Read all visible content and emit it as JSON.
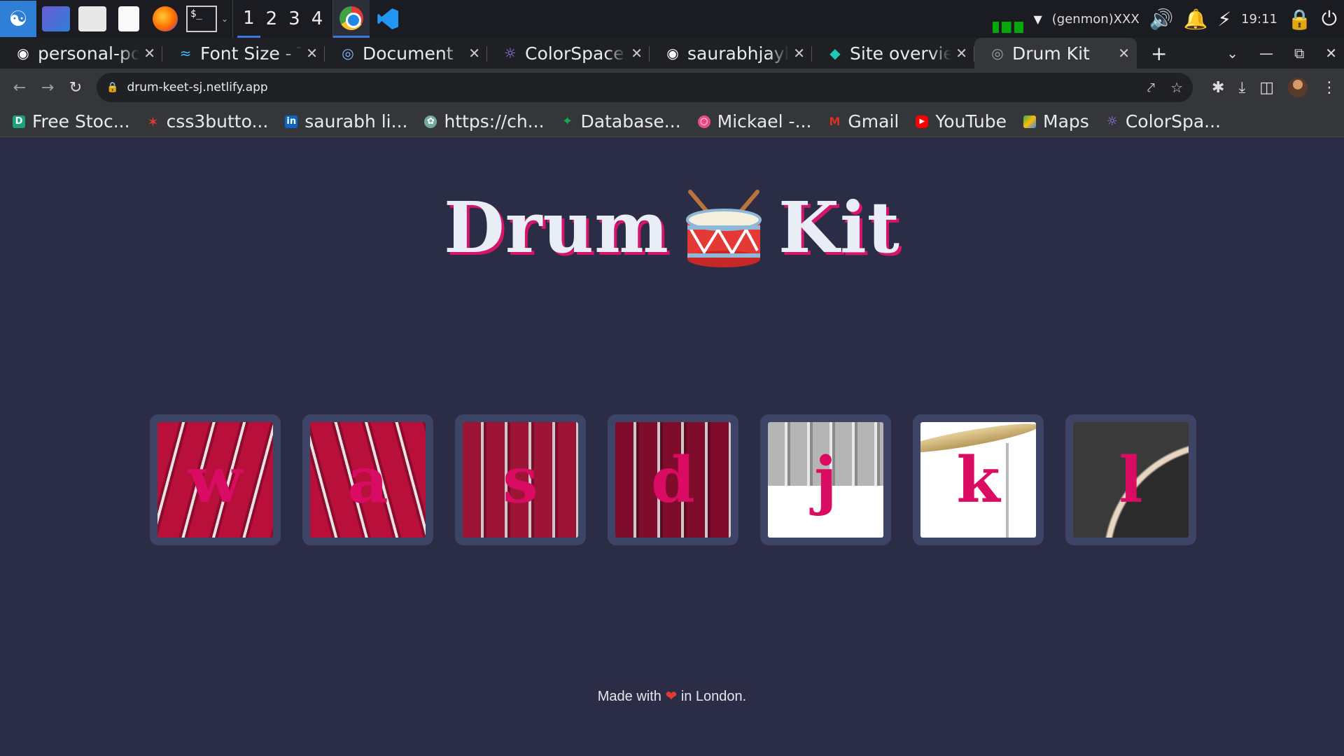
{
  "taskbar": {
    "workspaces": [
      "1",
      "2",
      "3",
      "4"
    ],
    "active_workspace": "1",
    "terminal_label": "$_",
    "genmon_text": "(genmon)XXX",
    "clock": "19:11"
  },
  "tabs": [
    {
      "title": "personal-portfolio",
      "favicon": "github-icon"
    },
    {
      "title": "Font Size - Tailwind CSS",
      "favicon": "tailwind-icon"
    },
    {
      "title": "Document",
      "favicon": "globe-icon"
    },
    {
      "title": "ColorSpace - Color Palettes",
      "favicon": "colorspace-icon"
    },
    {
      "title": "saurabhjaykar",
      "favicon": "github-icon"
    },
    {
      "title": "Site overview",
      "favicon": "netlify-icon"
    },
    {
      "title": "Drum Kit",
      "favicon": "globe-icon",
      "active": true
    }
  ],
  "toolbar": {
    "url": "drum-keet-sj.netlify.app"
  },
  "bookmarks": [
    {
      "label": "Free Stoc...",
      "icon": "square-icon",
      "color": "#1aa37a"
    },
    {
      "label": "css3butto...",
      "icon": "star-icon",
      "color": "#e53935"
    },
    {
      "label": "saurabh li...",
      "icon": "linkedin-icon",
      "color": "#0a66c2"
    },
    {
      "label": "https://ch...",
      "icon": "openai-icon",
      "color": "#74aa9c"
    },
    {
      "label": "Database...",
      "icon": "mongodb-icon",
      "color": "#13aa52"
    },
    {
      "label": "Mickael -...",
      "icon": "dribbble-icon",
      "color": "#ea4c89"
    },
    {
      "label": "Gmail",
      "icon": "gmail-icon",
      "color": "#d93025"
    },
    {
      "label": "YouTube",
      "icon": "youtube-icon",
      "color": "#ff0000"
    },
    {
      "label": "Maps",
      "icon": "maps-icon",
      "color": "#34a853"
    },
    {
      "label": "ColorSpa...",
      "icon": "colorspace-icon",
      "color": "#7b61ff"
    }
  ],
  "page": {
    "title_left": "Drum",
    "title_right": "Kit",
    "title_emoji": "drum-icon",
    "accent_color": "#da0b62",
    "background_color": "#2a2d45",
    "keys": [
      {
        "letter": "w",
        "sound": "tom-1"
      },
      {
        "letter": "a",
        "sound": "tom-2"
      },
      {
        "letter": "s",
        "sound": "tom-3"
      },
      {
        "letter": "d",
        "sound": "tom-4"
      },
      {
        "letter": "j",
        "sound": "snare"
      },
      {
        "letter": "k",
        "sound": "crash"
      },
      {
        "letter": "l",
        "sound": "kick-bass"
      }
    ],
    "footer_before": "Made with",
    "footer_after": "in London."
  }
}
